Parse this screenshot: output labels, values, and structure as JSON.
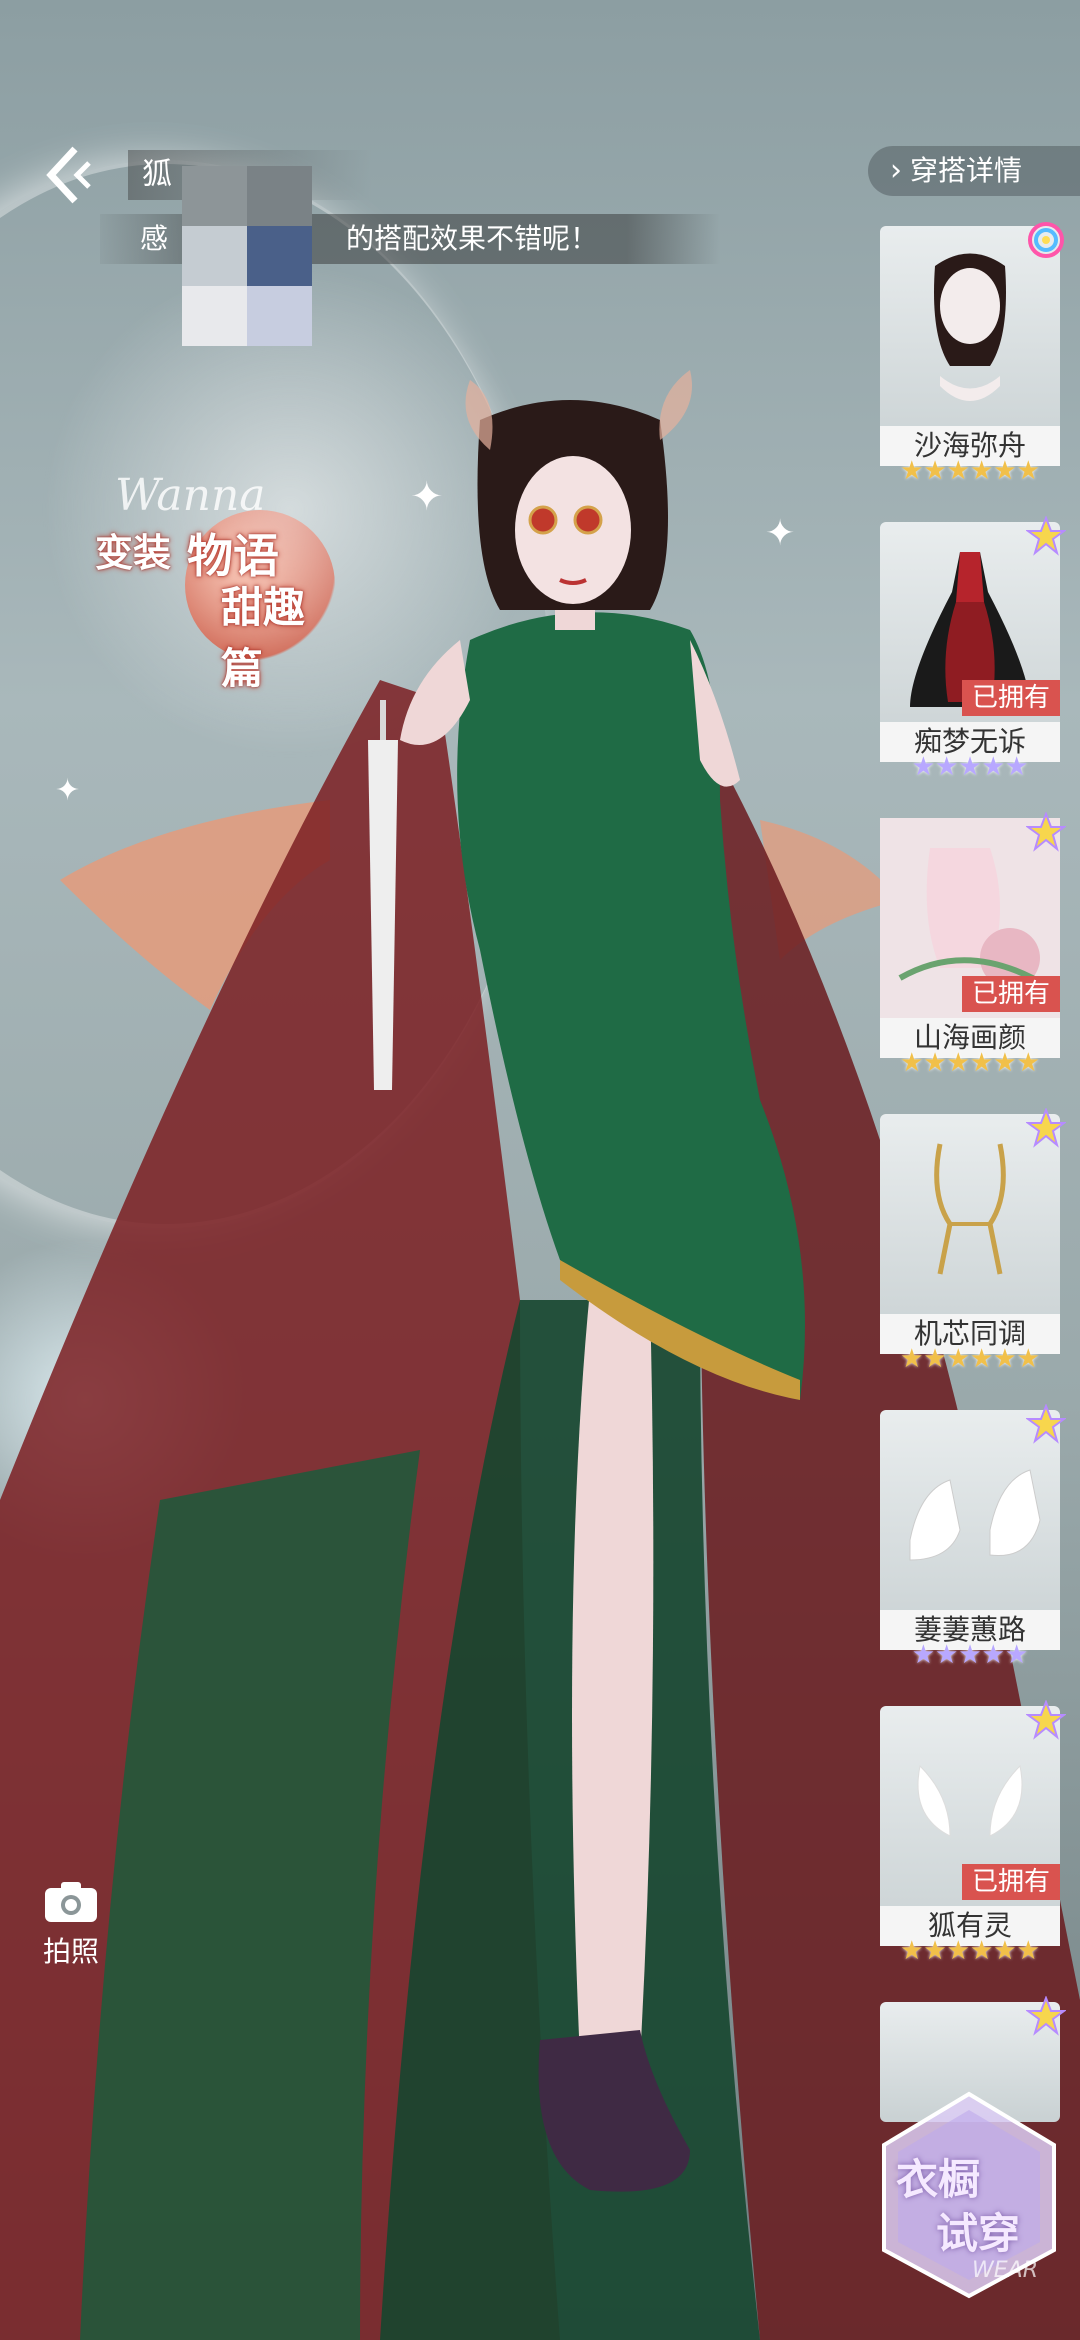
{
  "header": {
    "player_name": "狐",
    "message_prefix": "感",
    "message_suffix": "的搭配效果不错呢！"
  },
  "event_logo": {
    "script": "Wanna",
    "line1": "变装",
    "line2": "物语",
    "line3": "甜趣篇"
  },
  "outfit_detail": {
    "label": "穿搭详情"
  },
  "items": [
    {
      "name": "沙海弥舟",
      "owned": "",
      "stars": "★★★★★★",
      "star_color": "gold"
    },
    {
      "name": "痴梦无诉",
      "owned": "已拥有",
      "stars": "★★★★★",
      "star_color": "purple"
    },
    {
      "name": "山海画颜",
      "owned": "已拥有",
      "stars": "★★★★★★",
      "star_color": "gold"
    },
    {
      "name": "机芯同调",
      "owned": "",
      "stars": "★★★★★★",
      "star_color": "gold"
    },
    {
      "name": "萋萋蕙路",
      "owned": "",
      "stars": "★★★★★",
      "star_color": "purple"
    },
    {
      "name": "狐有灵",
      "owned": "已拥有",
      "stars": "★★★★★★",
      "star_color": "gold"
    },
    {
      "name": "",
      "owned": "",
      "stars": "",
      "star_color": "gold"
    }
  ],
  "photo": {
    "label": "拍照"
  },
  "wardrobe": {
    "line1": "衣橱",
    "line2": "试穿",
    "sub": "WEAR"
  },
  "colors": {
    "owned_red": "#d9534f",
    "star_gold": "#f1c04a",
    "star_purple": "#b8a8ff",
    "dress_green": "#1f6b45",
    "veil_red": "#7b1f22"
  }
}
